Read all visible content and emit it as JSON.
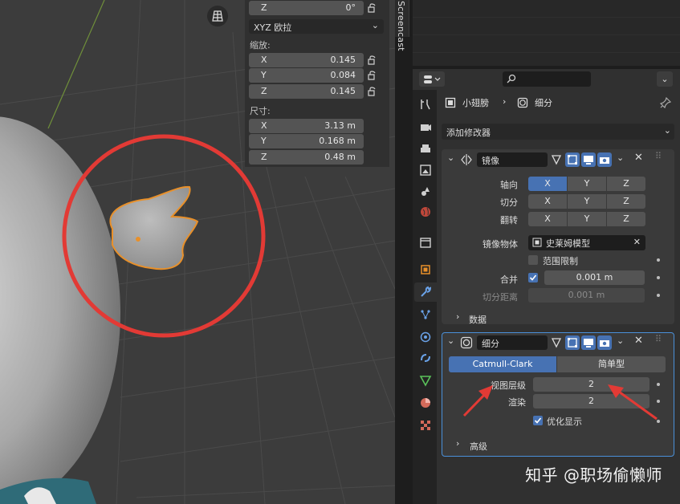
{
  "viewport": {
    "transform": {
      "rotation_z": {
        "axis": "Z",
        "value": "0°"
      },
      "rotation_mode": "XYZ 欧拉",
      "scale_label": "缩放:",
      "scale": [
        {
          "axis": "X",
          "value": "0.145"
        },
        {
          "axis": "Y",
          "value": "0.084"
        },
        {
          "axis": "Z",
          "value": "0.145"
        }
      ],
      "dimensions_label": "尺寸:",
      "dimensions": [
        {
          "axis": "X",
          "value": "3.13 m"
        },
        {
          "axis": "Y",
          "value": "0.168 m"
        },
        {
          "axis": "Z",
          "value": "0.48 m"
        }
      ]
    },
    "side_tab": "Screencast"
  },
  "properties": {
    "breadcrumb": {
      "object": "小翅膀",
      "modifier": "细分"
    },
    "add_modifier": "添加修改器",
    "mirror": {
      "name": "镜像",
      "axis_label": "轴向",
      "bisect_label": "切分",
      "flip_label": "翻转",
      "x": "X",
      "y": "Y",
      "z": "Z",
      "mirror_object_label": "镜像物体",
      "mirror_object": "史莱姆模型",
      "clipping_label": "范围限制",
      "merge_label": "合并",
      "merge_value": "0.001 m",
      "bisect_distance_label": "切分距离",
      "bisect_distance_value": "0.001 m",
      "data_label": "数据"
    },
    "subdivision": {
      "name": "细分",
      "mode_catmull": "Catmull-Clark",
      "mode_simple": "简单型",
      "viewport_levels_label": "视图层级",
      "viewport_levels": "2",
      "render_label": "渲染",
      "render_levels": "2",
      "optimal_display_label": "优化显示",
      "advanced_label": "高级"
    }
  },
  "watermark": "知乎 @职场偷懒师",
  "colors": {
    "accent": "#4772b3",
    "annotation_red": "#e23a35",
    "selection_orange": "#e8902a"
  }
}
